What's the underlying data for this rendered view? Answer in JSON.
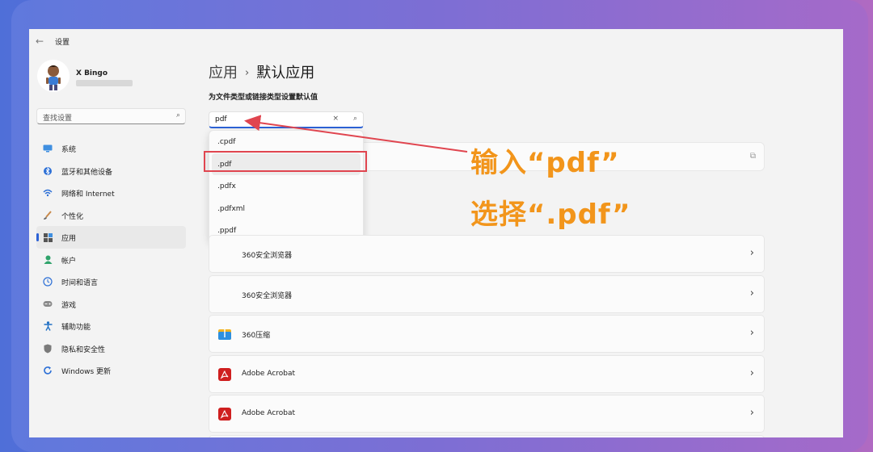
{
  "window": {
    "title": "设置"
  },
  "profile": {
    "name": "X Bingo"
  },
  "sidebar": {
    "search_placeholder": "查找设置",
    "items": [
      {
        "label": "系统",
        "icon": "system-icon"
      },
      {
        "label": "蓝牙和其他设备",
        "icon": "bluetooth-icon"
      },
      {
        "label": "网络和 Internet",
        "icon": "wifi-icon"
      },
      {
        "label": "个性化",
        "icon": "brush-icon"
      },
      {
        "label": "应用",
        "icon": "apps-icon",
        "active": true
      },
      {
        "label": "帐户",
        "icon": "account-icon"
      },
      {
        "label": "时间和语言",
        "icon": "globe-clock-icon"
      },
      {
        "label": "游戏",
        "icon": "gamepad-icon"
      },
      {
        "label": "辅助功能",
        "icon": "accessibility-icon"
      },
      {
        "label": "隐私和安全性",
        "icon": "shield-icon"
      },
      {
        "label": "Windows 更新",
        "icon": "update-icon"
      }
    ]
  },
  "main": {
    "breadcrumb_root": "应用",
    "breadcrumb_separator": "›",
    "breadcrumb_current": "默认应用",
    "subtitle": "为文件类型或链接类型设置默认值",
    "search": {
      "value": "pdf",
      "clear_icon": "×"
    },
    "dropdown": [
      ".cpdf",
      ".pdf",
      ".pdfx",
      ".pdfxml",
      ".ppdf"
    ],
    "apps": [
      {
        "name": "360安全浏览器"
      },
      {
        "name": "360安全浏览器"
      },
      {
        "name": "360压缩"
      },
      {
        "name": "Adobe Acrobat"
      },
      {
        "name": "Adobe Acrobat"
      }
    ]
  },
  "annotations": {
    "line1": "输入“pdf”",
    "line2": "选择“.pdf”",
    "color": "#f2951b",
    "highlight_color": "#e0454f"
  },
  "accent": "#2c62d6"
}
